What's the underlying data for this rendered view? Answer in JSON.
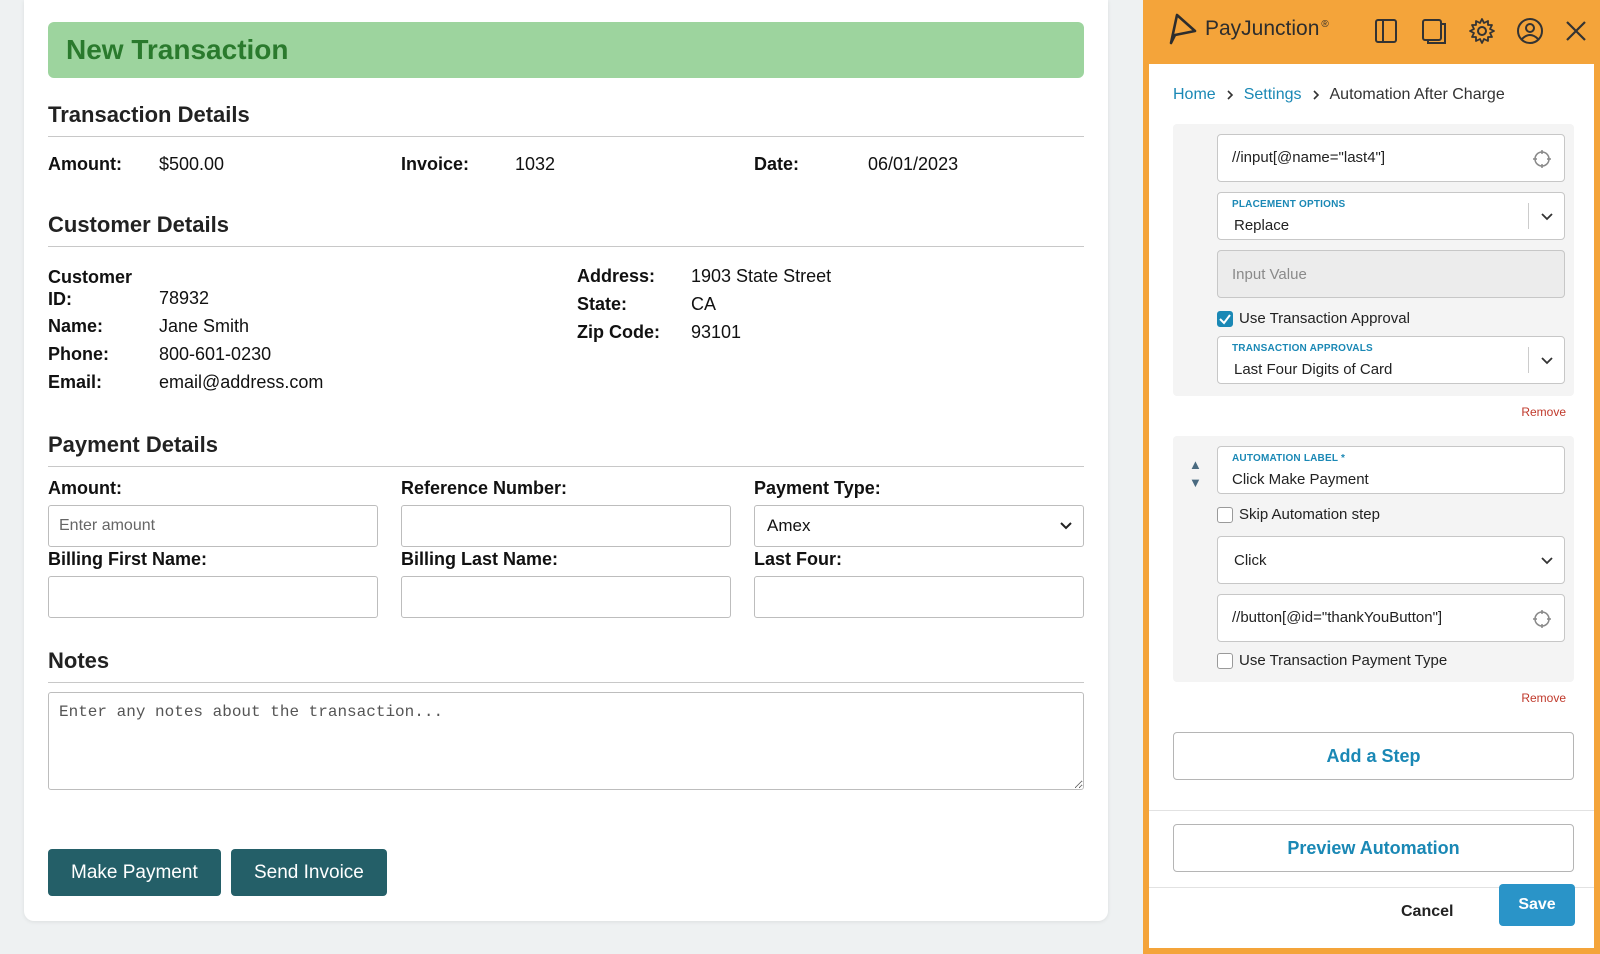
{
  "form": {
    "title": "New Transaction",
    "transaction_details": {
      "heading": "Transaction Details",
      "amount_label": "Amount:",
      "amount_value": "$500.00",
      "invoice_label": "Invoice:",
      "invoice_value": "1032",
      "date_label": "Date:",
      "date_value": "06/01/2023"
    },
    "customer_details": {
      "heading": "Customer Details",
      "customer_id_label": "Customer ID:",
      "customer_id_value": "78932",
      "name_label": "Name:",
      "name_value": "Jane Smith",
      "phone_label": "Phone:",
      "phone_value": "800-601-0230",
      "email_label": "Email:",
      "email_value": "email@address.com",
      "address_label": "Address:",
      "address_value": "1903 State Street",
      "state_label": "State:",
      "state_value": "CA",
      "zip_label": "Zip Code:",
      "zip_value": "93101"
    },
    "payment_details": {
      "heading": "Payment Details",
      "amount_label": "Amount:",
      "amount_placeholder": "Enter amount",
      "reference_label": "Reference Number:",
      "payment_type_label": "Payment Type:",
      "payment_type_value": "Amex",
      "billing_first_label": "Billing First Name:",
      "billing_last_label": "Billing Last Name:",
      "last_four_label": "Last Four:"
    },
    "notes": {
      "heading": "Notes",
      "placeholder": "Enter any notes about the transaction..."
    },
    "buttons": {
      "make_payment": "Make Payment",
      "send_invoice": "Send Invoice"
    }
  },
  "panel": {
    "brand": "PayJunction",
    "brand_mark": "®",
    "icons": [
      "split-view-icon",
      "popout-icon",
      "gear-icon",
      "user-icon",
      "close-icon"
    ],
    "breadcrumbs": [
      "Home",
      "Settings",
      "Automation After Charge"
    ],
    "step1": {
      "xpath": "//input[@name=\"last4\"]",
      "placement_label": "PLACEMENT OPTIONS",
      "placement_value": "Replace",
      "input_value_placeholder": "Input Value",
      "use_approval_label": "Use Transaction Approval",
      "use_approval_checked": true,
      "approvals_label": "TRANSACTION APPROVALS",
      "approvals_value": "Last Four Digits of Card",
      "remove": "Remove"
    },
    "step2": {
      "label_caption": "AUTOMATION LABEL *",
      "label_value": "Click Make Payment",
      "skip_label": "Skip Automation step",
      "skip_checked": false,
      "action_value": "Click",
      "xpath": "//button[@id=\"thankYouButton\"]",
      "use_payment_type_label": "Use Transaction Payment Type",
      "use_payment_type_checked": false,
      "remove": "Remove",
      "move_up": "▲",
      "move_down": "▼"
    },
    "add_step": "Add a Step",
    "preview": "Preview Automation",
    "cancel": "Cancel",
    "save": "Save"
  },
  "colors": {
    "accent_orange": "#f4a43a",
    "banner_green": "#9dd49e",
    "title_green": "#2a7a2d",
    "dark_teal_button": "#245f68",
    "link_blue": "#1a88b5",
    "remove_red": "#c0392b",
    "save_blue": "#2a94c8"
  }
}
